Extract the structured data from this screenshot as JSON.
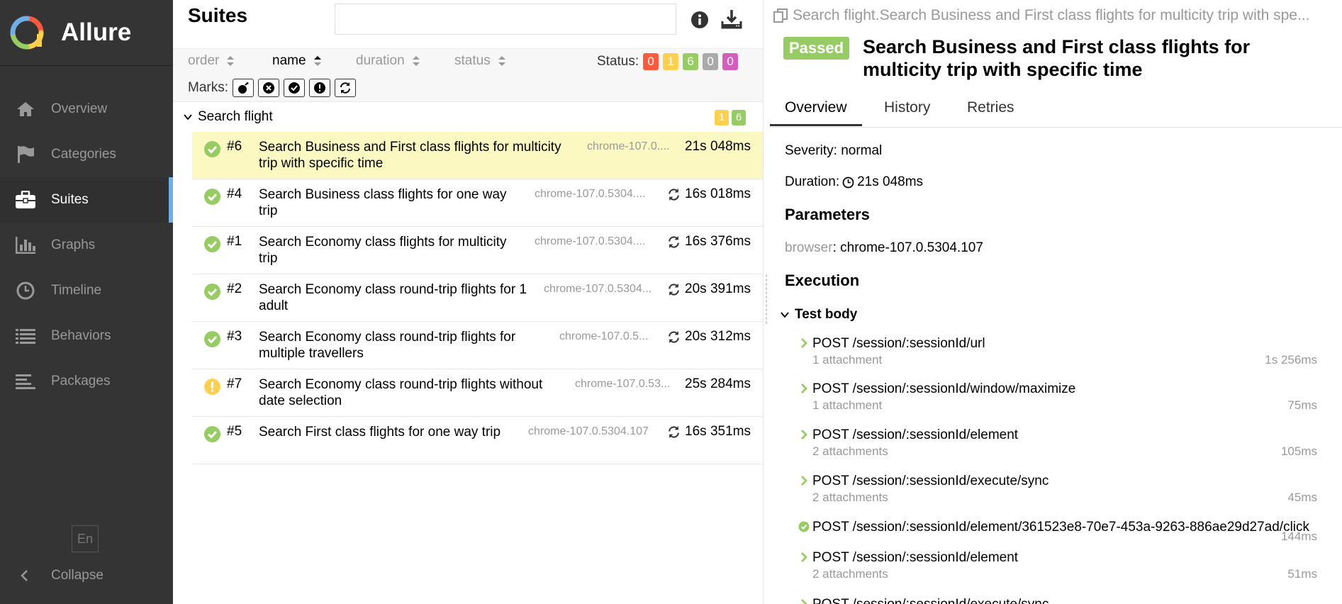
{
  "sidebar": {
    "brand": "Allure",
    "items": [
      {
        "label": "Overview",
        "icon": "home-icon",
        "active": false
      },
      {
        "label": "Categories",
        "icon": "flag-icon",
        "active": false
      },
      {
        "label": "Suites",
        "icon": "briefcase-icon",
        "active": true
      },
      {
        "label": "Graphs",
        "icon": "bar-chart-icon",
        "active": false
      },
      {
        "label": "Timeline",
        "icon": "clock-icon",
        "active": false
      },
      {
        "label": "Behaviors",
        "icon": "list-icon",
        "active": false
      },
      {
        "label": "Packages",
        "icon": "align-left-icon",
        "active": false
      }
    ],
    "lang": "En",
    "collapse": "Collapse"
  },
  "suites": {
    "title": "Suites",
    "search_value": "",
    "sort": {
      "order": "order",
      "name": "name",
      "duration": "duration",
      "status": "status"
    },
    "status_label": "Status:",
    "status_counts": [
      {
        "value": "0",
        "color": "#fd5a3e"
      },
      {
        "value": "1",
        "color": "#ffd050"
      },
      {
        "value": "6",
        "color": "#97cc64"
      },
      {
        "value": "0",
        "color": "#aaaaaa"
      },
      {
        "value": "0",
        "color": "#d35ebe"
      }
    ],
    "marks_label": "Marks:",
    "group": {
      "name": "Search flight",
      "counts": [
        {
          "value": "1",
          "color": "#ffd050"
        },
        {
          "value": "6",
          "color": "#97cc64"
        }
      ]
    },
    "tests": [
      {
        "num": "#6",
        "name1": "Search Business and First class flights for multicity",
        "name2": "trip with specific time",
        "param": "chrome-107.0....",
        "duration": "21s 048ms",
        "status": "passed",
        "retry": false,
        "selected": true
      },
      {
        "num": "#4",
        "name1": "Search Business class flights for one way",
        "name2": "trip",
        "param": "chrome-107.0.5304....",
        "duration": "16s 018ms",
        "status": "passed",
        "retry": true,
        "selected": false
      },
      {
        "num": "#1",
        "name1": "Search Economy class flights for multicity",
        "name2": "trip",
        "param": "chrome-107.0.5304....",
        "duration": "16s 376ms",
        "status": "passed",
        "retry": true,
        "selected": false
      },
      {
        "num": "#2",
        "name1": "Search Economy class round-trip flights for 1",
        "name2": "adult",
        "param": "chrome-107.0.5304...",
        "duration": "20s 391ms",
        "status": "passed",
        "retry": true,
        "selected": false
      },
      {
        "num": "#3",
        "name1": "Search Economy class round-trip flights for",
        "name2": "multiple travellers",
        "param": "chrome-107.0.5...",
        "duration": "20s 312ms",
        "status": "passed",
        "retry": true,
        "selected": false
      },
      {
        "num": "#7",
        "name1": "Search Economy class round-trip flights without",
        "name2": "date selection",
        "param": "chrome-107.0.53...",
        "duration": "25s 284ms",
        "status": "broken",
        "retry": false,
        "selected": false
      },
      {
        "num": "#5",
        "name1": "Search First class flights for one way trip",
        "name2": "",
        "param": "chrome-107.0.5304.107",
        "duration": "16s 351ms",
        "status": "passed",
        "retry": true,
        "selected": false
      }
    ]
  },
  "detail": {
    "breadcrumb": "Search flight.Search Business and First class flights for multicity trip with spe...",
    "status_badge": "Passed",
    "title": "Search Business and First class flights for multicity trip with specific time",
    "tabs": [
      "Overview",
      "History",
      "Retries"
    ],
    "severity": "Severity: normal",
    "duration_label": "Duration:",
    "duration_value": "21s 048ms",
    "parameters_heading": "Parameters",
    "param_key": "browser",
    "param_value": ": chrome-107.0.5304.107",
    "execution_heading": "Execution",
    "test_body": "Test body",
    "steps": [
      {
        "name": "POST /session/:sessionId/url",
        "sub": "1 attachment",
        "duration": "1s 256ms",
        "icon": "chevron-right-icon"
      },
      {
        "name": "POST /session/:sessionId/window/maximize",
        "sub": "1 attachment",
        "duration": "75ms",
        "icon": "chevron-right-icon"
      },
      {
        "name": "POST /session/:sessionId/element",
        "sub": "2 attachments",
        "duration": "105ms",
        "icon": "chevron-right-icon"
      },
      {
        "name": "POST /session/:sessionId/execute/sync",
        "sub": "2 attachments",
        "duration": "45ms",
        "icon": "chevron-right-icon"
      },
      {
        "name": "POST /session/:sessionId/element/361523e8-70e7-453a-9263-886ae29d27ad/click",
        "sub": "",
        "duration": "144ms",
        "icon": "check-circle-icon"
      },
      {
        "name": "POST /session/:sessionId/element",
        "sub": "2 attachments",
        "duration": "51ms",
        "icon": "chevron-right-icon"
      },
      {
        "name": "POST /session/:sessionId/execute/sync",
        "sub": "",
        "duration": "",
        "icon": "chevron-right-icon"
      }
    ]
  },
  "colors": {
    "passed": "#97cc64",
    "broken": "#ffd050",
    "accent": "#6faee7"
  }
}
